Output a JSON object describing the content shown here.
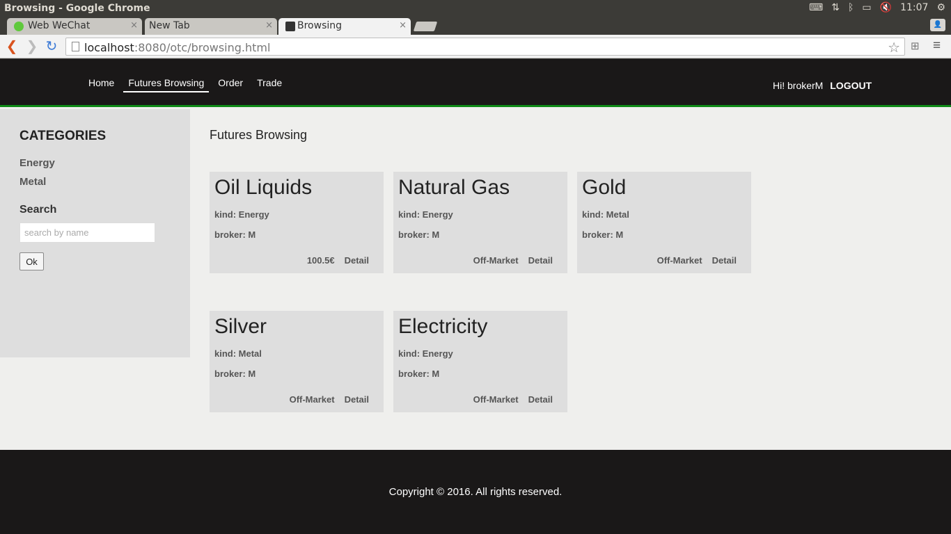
{
  "os": {
    "window_title": "Browsing - Google Chrome",
    "clock": "11:07"
  },
  "browser": {
    "tabs": [
      {
        "label": "Web WeChat",
        "close": "×"
      },
      {
        "label": "New Tab",
        "close": "×"
      },
      {
        "label": "Browsing",
        "close": "×"
      }
    ],
    "url_host": "localhost",
    "url_rest": ":8080/otc/browsing.html"
  },
  "site": {
    "nav": [
      "Home",
      "Futures Browsing",
      "Order",
      "Trade"
    ],
    "active_nav": "Futures Browsing",
    "greeting": "Hi! brokerM",
    "logout": "LOGOUT"
  },
  "sidebar": {
    "title": "CATEGORIES",
    "categories": [
      "Energy",
      "Metal"
    ],
    "search_title": "Search",
    "search_placeholder": "search by name",
    "ok_label": "Ok"
  },
  "main": {
    "title": "Futures Browsing",
    "cards": [
      {
        "name": "Oil Liquids",
        "kind": "kind: Energy",
        "broker": "broker: M",
        "status": "100.5€",
        "detail": "Detail"
      },
      {
        "name": "Natural Gas",
        "kind": "kind: Energy",
        "broker": "broker: M",
        "status": "Off-Market",
        "detail": "Detail"
      },
      {
        "name": "Gold",
        "kind": "kind: Metal",
        "broker": "broker: M",
        "status": "Off-Market",
        "detail": "Detail"
      },
      {
        "name": "Silver",
        "kind": "kind: Metal",
        "broker": "broker: M",
        "status": "Off-Market",
        "detail": "Detail"
      },
      {
        "name": "Electricity",
        "kind": "kind: Energy",
        "broker": "broker: M",
        "status": "Off-Market",
        "detail": "Detail"
      }
    ]
  },
  "footer": {
    "text": "Copyright © 2016. All rights reserved."
  },
  "colors": {
    "header_bg": "#1a1818",
    "accent_green": "#0e8a16",
    "card_bg": "#dedede",
    "page_bg": "#efefed"
  }
}
